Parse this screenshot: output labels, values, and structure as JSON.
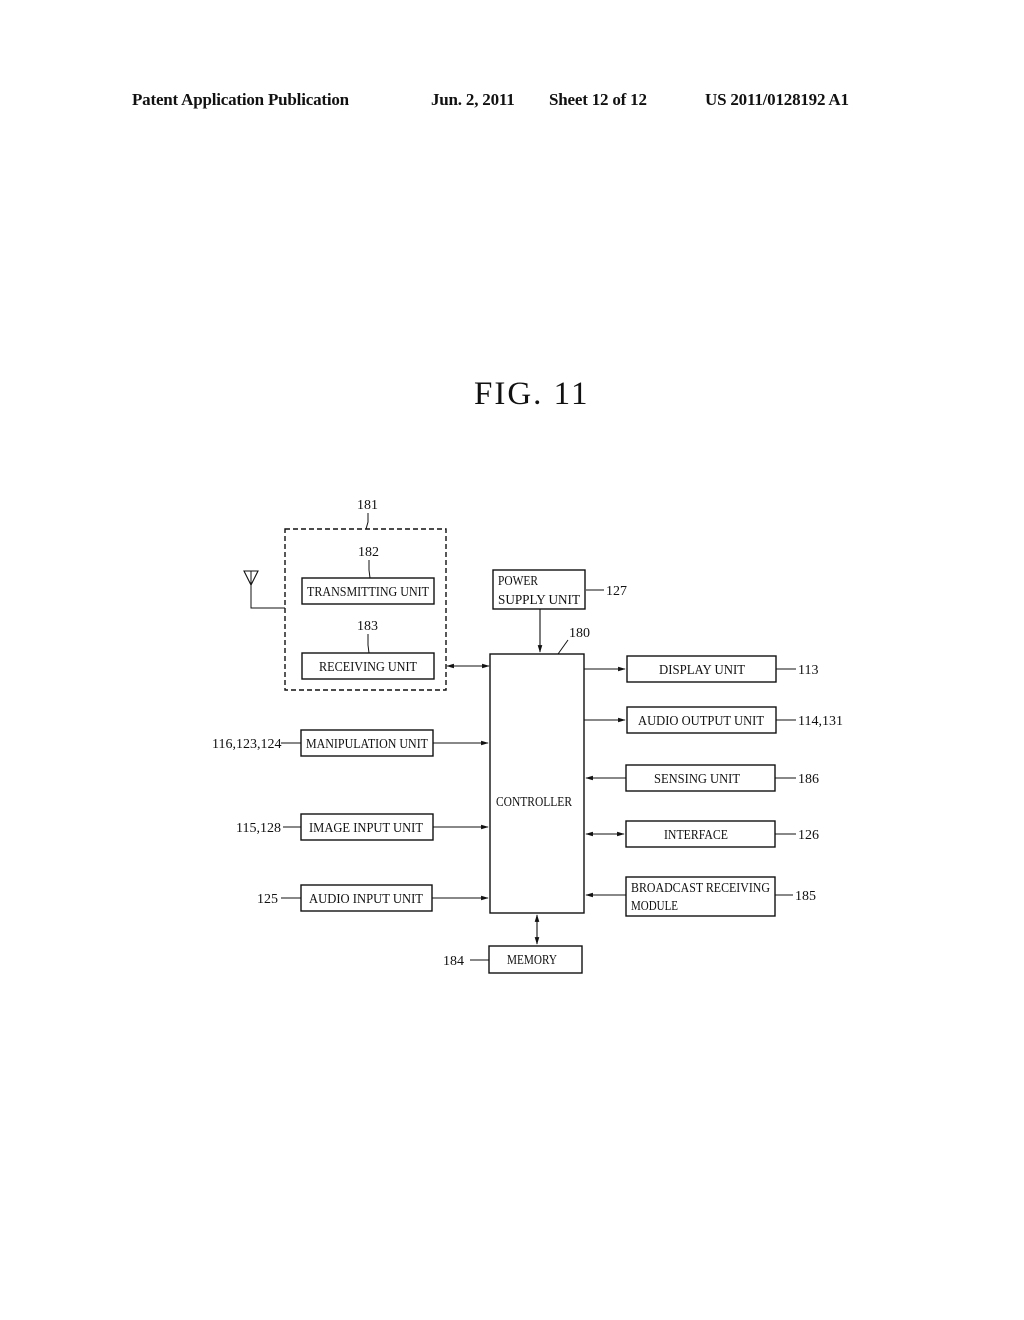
{
  "header": {
    "publication": "Patent Application Publication",
    "date": "Jun. 2, 2011",
    "sheet": "Sheet 12 of 12",
    "number": "US 2011/0128192 A1"
  },
  "figure": {
    "title": "FIG.  11"
  },
  "diagram": {
    "group": {
      "ref": "181"
    },
    "blocks": {
      "transmitting": {
        "label": "TRANSMITTING  UNIT",
        "ref": "182"
      },
      "receiving": {
        "label": "RECEIVING  UNIT",
        "ref": "183"
      },
      "power_supply": {
        "label_line1": "POWER",
        "label_line2": "SUPPLY  UNIT",
        "ref": "127"
      },
      "controller": {
        "label": "CONTROLLER",
        "ref": "180"
      },
      "display": {
        "label": "DISPLAY  UNIT",
        "ref": "113"
      },
      "audio_output": {
        "label": "AUDIO  OUTPUT  UNIT",
        "ref": "114,131"
      },
      "sensing": {
        "label": "SENSING  UNIT",
        "ref": "186"
      },
      "interface": {
        "label": "INTERFACE",
        "ref": "126"
      },
      "broadcast": {
        "label_line1": "BROADCAST  RECEIVING",
        "label_line2": "MODULE",
        "ref": "185"
      },
      "manipulation": {
        "label": "MANIPULATION  UNIT",
        "ref": "116,123,124"
      },
      "image_input": {
        "label": "IMAGE  INPUT  UNIT",
        "ref": "115,128"
      },
      "audio_input": {
        "label": "AUDIO  INPUT  UNIT",
        "ref": "125"
      },
      "memory": {
        "label": "MEMORY",
        "ref": "184"
      }
    }
  }
}
